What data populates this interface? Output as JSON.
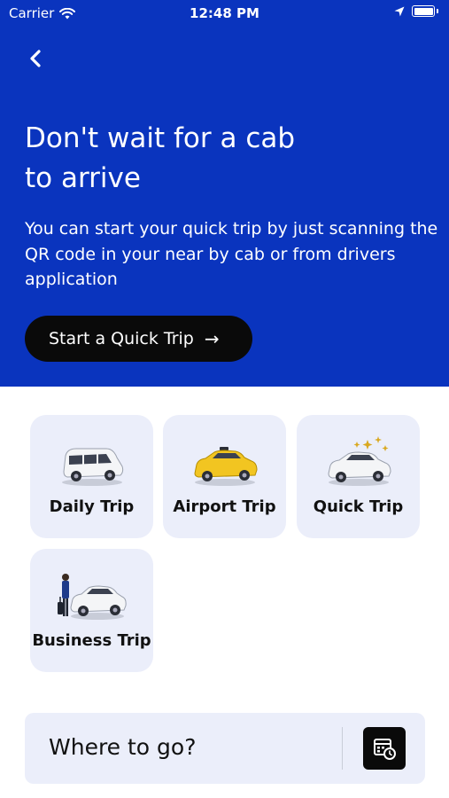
{
  "status": {
    "carrier": "Carrier",
    "time": "12:48 PM"
  },
  "hero": {
    "title_line1": "Don't wait for a cab",
    "title_line2": "to arrive",
    "subtitle": "You can start your quick trip by just scanning the QR code in your near by cab or from drivers application",
    "cta_label": "Start a Quick Trip",
    "cta_arrow": "→"
  },
  "trip_types": [
    {
      "label": "Daily Trip",
      "icon": "white-van-icon"
    },
    {
      "label": "Airport Trip",
      "icon": "yellow-taxi-icon"
    },
    {
      "label": "Quick Trip",
      "icon": "sparkle-car-icon"
    },
    {
      "label": "Business Trip",
      "icon": "business-traveler-car-icon"
    }
  ],
  "search": {
    "label": "Where to go?",
    "icon": "schedule-calendar-icon"
  },
  "colors": {
    "hero_bg": "#0a34be",
    "tile_bg": "#ebeefa",
    "cta_bg": "#0a0a0a"
  }
}
